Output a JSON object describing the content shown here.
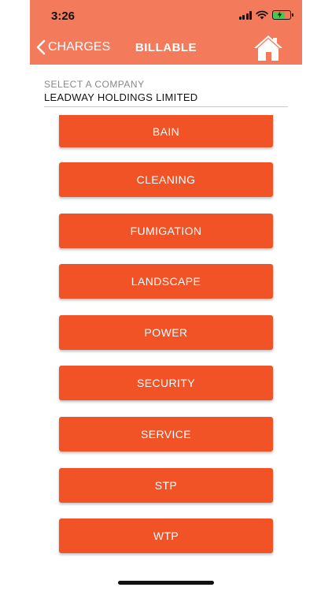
{
  "status": {
    "time": "3:26"
  },
  "nav": {
    "back_label": "CHARGES",
    "title": "BILLABLE"
  },
  "company": {
    "label": "SELECT A COMPANY",
    "value": "LEADWAY HOLDINGS LIMITED"
  },
  "charges": [
    "BAIN",
    "CLEANING",
    "FUMIGATION",
    "LANDSCAPE",
    "POWER",
    "SECURITY",
    "SERVICE",
    "STP",
    "WTP"
  ],
  "colors": {
    "header": "#f47a5c",
    "button": "#f15226",
    "text_on_accent": "#ffffff",
    "battery": "#46c94a"
  }
}
